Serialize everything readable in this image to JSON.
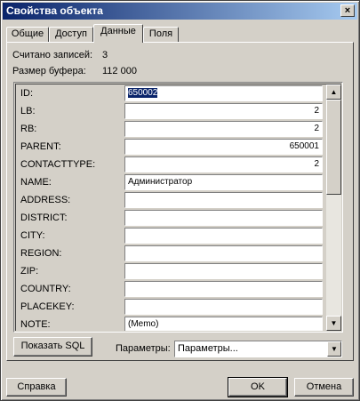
{
  "window": {
    "title": "Свойства объекта",
    "close_symbol": "×"
  },
  "tabs": [
    {
      "label": "Общие",
      "active": false
    },
    {
      "label": "Доступ",
      "active": false
    },
    {
      "label": "Данные",
      "active": true
    },
    {
      "label": "Поля",
      "active": false
    }
  ],
  "info": {
    "records_label": "Считано записей:",
    "records_value": "3",
    "buffer_label": "Размер буфера:",
    "buffer_value": "112 000"
  },
  "fields": [
    {
      "label": "ID:",
      "value": "650002"
    },
    {
      "label": "LB:",
      "value": "2"
    },
    {
      "label": "RB:",
      "value": "2"
    },
    {
      "label": "PARENT:",
      "value": "650001"
    },
    {
      "label": "CONTACTTYPE:",
      "value": "2"
    },
    {
      "label": "NAME:",
      "value": "Администратор"
    },
    {
      "label": "ADDRESS:",
      "value": ""
    },
    {
      "label": "DISTRICT:",
      "value": ""
    },
    {
      "label": "CITY:",
      "value": ""
    },
    {
      "label": "REGION:",
      "value": ""
    },
    {
      "label": "ZIP:",
      "value": ""
    },
    {
      "label": "COUNTRY:",
      "value": ""
    },
    {
      "label": "PLACEKEY:",
      "value": ""
    },
    {
      "label": "NOTE:",
      "value": "(Memo)"
    }
  ],
  "scrollbar": {
    "up_symbol": "▲",
    "down_symbol": "▼"
  },
  "actions": {
    "show_sql": "Показать SQL",
    "params_label": "Параметры:",
    "params_value": "Параметры...",
    "dropdown_symbol": "▼"
  },
  "footer": {
    "help": "Справка",
    "ok": "OK",
    "cancel": "Отмена"
  }
}
